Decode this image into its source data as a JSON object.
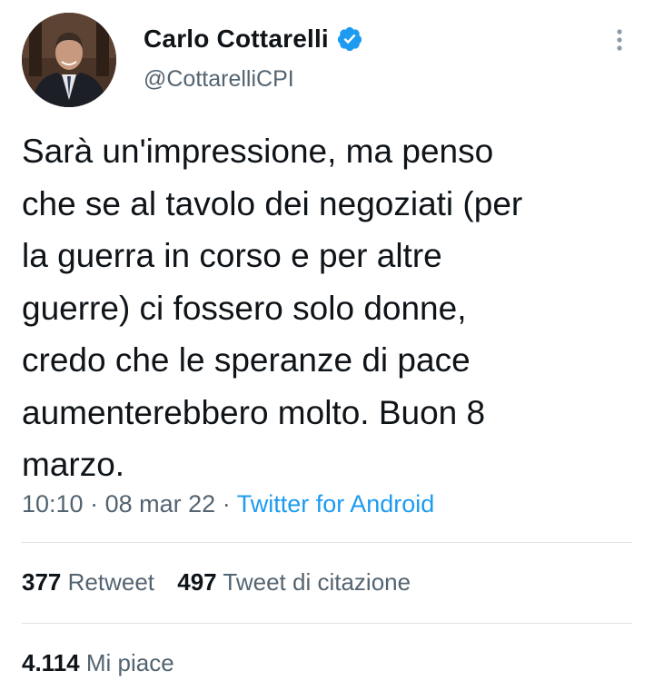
{
  "author": {
    "display_name": "Carlo Cottarelli",
    "handle": "@CottarelliCPI",
    "verified": true,
    "avatar_icon": "profile-photo",
    "verified_icon": "verified-badge-icon"
  },
  "tweet": {
    "text": "Sarà un'impressione, ma penso\nche se al tavolo dei negoziati (per\nla guerra in corso e per altre\nguerre) ci fossero solo donne,\ncredo che le speranze di pace\naumenterebbero molto. Buon 8\nmarzo.",
    "time": "10:10",
    "separator": "·",
    "date": "08 mar 22",
    "source": "Twitter for Android"
  },
  "stats": {
    "retweets_count": "377",
    "retweets_label": "Retweet",
    "quotes_count": "497",
    "quotes_label": "Tweet di citazione",
    "likes_count": "4.114",
    "likes_label": "Mi piace"
  },
  "colors": {
    "text": "#0f1419",
    "secondary": "#536471",
    "accent": "#1d9bf0",
    "divider": "#dfe3e6"
  }
}
